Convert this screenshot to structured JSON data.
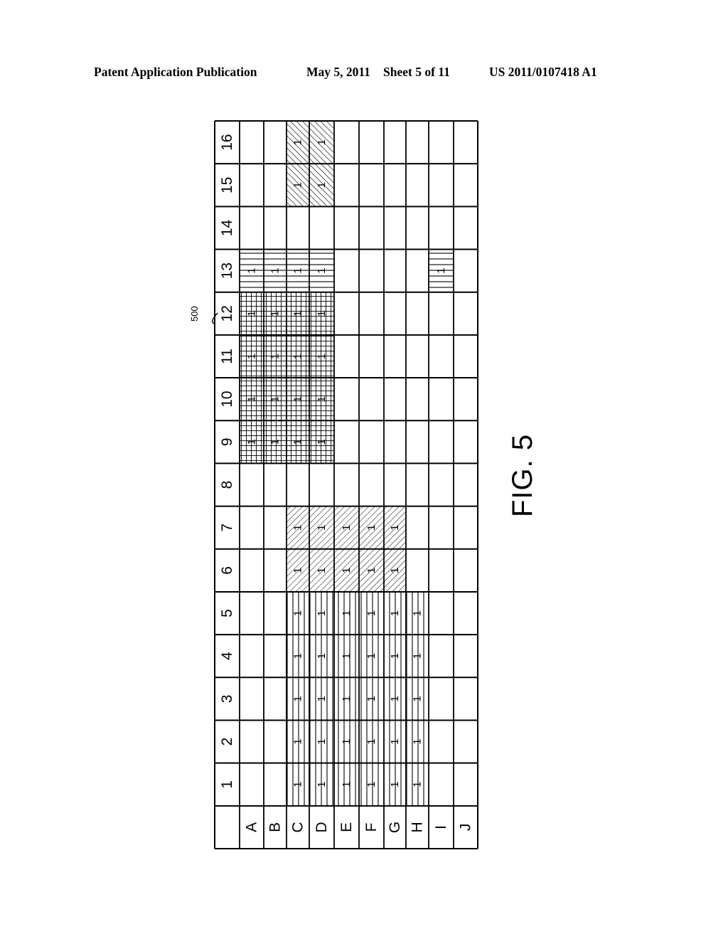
{
  "header": {
    "publication": "Patent Application Publication",
    "date": "May 5, 2011",
    "sheet": "Sheet 5 of 11",
    "number": "US 2011/0107418 A1"
  },
  "figure": {
    "label": "FIG. 5",
    "reference_numeral": "500",
    "orientation": "rotated 90 degrees counter-clockwise",
    "table": {
      "column_headers": [
        "A",
        "B",
        "C",
        "D",
        "E",
        "F",
        "G",
        "H",
        "I",
        "J"
      ],
      "row_headers": [
        "1",
        "2",
        "3",
        "4",
        "5",
        "6",
        "7",
        "8",
        "9",
        "10",
        "11",
        "12",
        "13",
        "14",
        "15",
        "16"
      ],
      "cell_value": "1",
      "regions": [
        {
          "name": "vertical-hatch-block",
          "pattern": "vertical-lines",
          "rows": [
            "1",
            "2",
            "3",
            "4",
            "5"
          ],
          "columns": [
            "C",
            "D",
            "E",
            "F",
            "G",
            "H"
          ]
        },
        {
          "name": "forward-diagonal-block",
          "pattern": "diagonal-forward",
          "rows": [
            "6",
            "7"
          ],
          "columns": [
            "C",
            "D",
            "E",
            "F",
            "G"
          ]
        },
        {
          "name": "crosshatch-block",
          "pattern": "crosshatch",
          "rows": [
            "9",
            "10",
            "11",
            "12"
          ],
          "columns": [
            "A",
            "B",
            "C",
            "D"
          ]
        },
        {
          "name": "horizontal-hatch-block",
          "pattern": "horizontal-lines",
          "rows": [
            "13"
          ],
          "columns": [
            "A",
            "B",
            "C",
            "D",
            "I"
          ]
        },
        {
          "name": "backward-diagonal-block",
          "pattern": "diagonal-backward",
          "rows": [
            "15",
            "16"
          ],
          "columns": [
            "C",
            "D"
          ]
        }
      ]
    }
  }
}
